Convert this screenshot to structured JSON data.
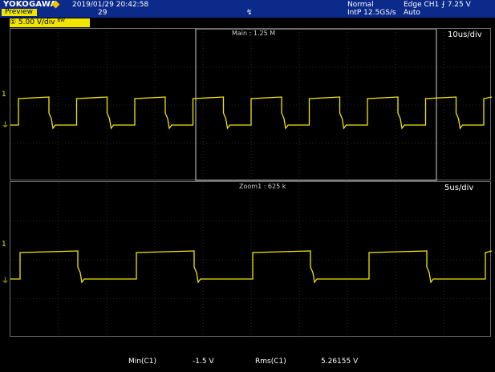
{
  "header": {
    "brand": "YOKOGAWA",
    "preview_label": "Preview",
    "timestamp": "2019/01/29 20:42:58",
    "acq_count": "29",
    "trigger_position_mark": "↯",
    "acq_mode": "Normal",
    "sample_rate": "IntP 12.5GS/s",
    "trigger_setting": "Edge CH1 ⨍ 7.25 V",
    "trigger_mode": "Auto"
  },
  "channel": {
    "tag": "① 5.00 V/div ᴮᵂ",
    "level_marker": "1",
    "ground_marker": "⏚"
  },
  "main_window": {
    "timebase": "10us/div",
    "zoom_box_label": "Main : 1.25 M"
  },
  "zoom_window": {
    "timebase": "5us/div",
    "zoom_label": "Zoom1 : 625 k"
  },
  "measurements": {
    "min_label": "Min(C1)",
    "min_value": "-1.5 V",
    "rms_label": "Rms(C1)",
    "rms_value": "5.26155 V"
  },
  "colors": {
    "trace": "#f2e600",
    "grid": "#4a4a4a",
    "header_bg": "#0b2a8a",
    "zoom_box": "#d0d0d0"
  }
}
